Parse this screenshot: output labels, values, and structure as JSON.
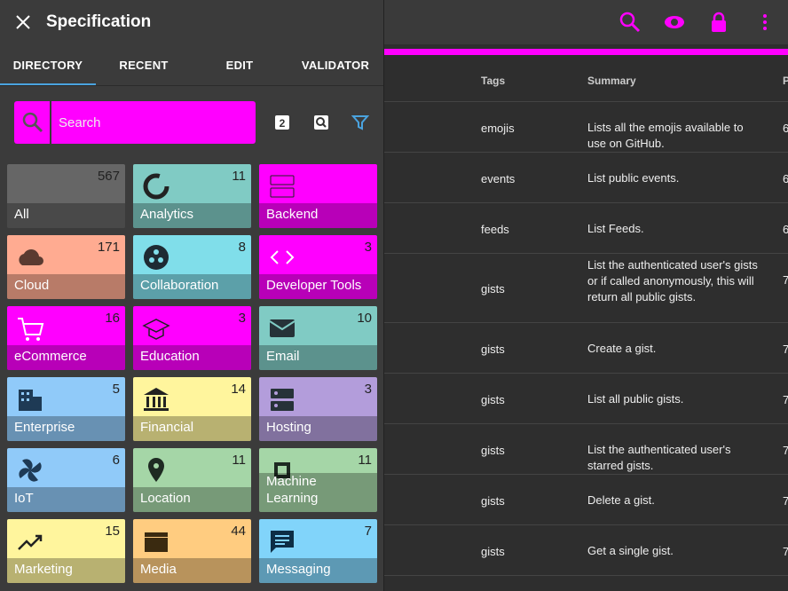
{
  "drawer": {
    "title": "Specification",
    "tabs": [
      "DIRECTORY",
      "RECENT",
      "EDIT",
      "VALIDATOR"
    ],
    "search_placeholder": "Search",
    "tiles": [
      {
        "label": "All",
        "count": "567",
        "color": "#666666",
        "icon": "none"
      },
      {
        "label": "Analytics",
        "count": "11",
        "color": "#80cbc4",
        "icon": "donut-icon"
      },
      {
        "label": "Backend",
        "count": "",
        "color": "#ff00ff",
        "icon": "server-icon"
      },
      {
        "label": "Cloud",
        "count": "171",
        "color": "#ffab91",
        "icon": "cloud-icon"
      },
      {
        "label": "Collaboration",
        "count": "8",
        "color": "#80deea",
        "icon": "group-icon"
      },
      {
        "label": "Developer Tools",
        "count": "3",
        "color": "#ff00ff",
        "icon": "code-icon"
      },
      {
        "label": "eCommerce",
        "count": "16",
        "color": "#ff00ff",
        "icon": "cart-icon"
      },
      {
        "label": "Education",
        "count": "3",
        "color": "#ff00ff",
        "icon": "school-icon"
      },
      {
        "label": "Email",
        "count": "10",
        "color": "#80cbc4",
        "icon": "mail-icon"
      },
      {
        "label": "Enterprise",
        "count": "5",
        "color": "#90caf9",
        "icon": "building-icon"
      },
      {
        "label": "Financial",
        "count": "14",
        "color": "#fff59d",
        "icon": "bank-icon"
      },
      {
        "label": "Hosting",
        "count": "3",
        "color": "#b39ddb",
        "icon": "dns-icon"
      },
      {
        "label": "IoT",
        "count": "6",
        "color": "#90caf9",
        "icon": "fan-icon"
      },
      {
        "label": "Location",
        "count": "11",
        "color": "#a5d6a7",
        "icon": "pin-icon"
      },
      {
        "label": "Machine Learning",
        "count": "11",
        "color": "#a5d6a7",
        "icon": "chip-icon"
      },
      {
        "label": "Marketing",
        "count": "15",
        "color": "#fff59d",
        "icon": "trend-icon"
      },
      {
        "label": "Media",
        "count": "44",
        "color": "#ffcc80",
        "icon": "clapper-icon"
      },
      {
        "label": "Messaging",
        "count": "7",
        "color": "#81d4fa",
        "icon": "message-icon"
      }
    ]
  },
  "table": {
    "headers": {
      "tags": "Tags",
      "summary": "Summary",
      "extra": "P"
    },
    "rows": [
      {
        "tag": "emojis",
        "summary": "Lists all the emojis available to use on GitHub.",
        "extra": "6"
      },
      {
        "tag": "events",
        "summary": "List public events.",
        "extra": "6"
      },
      {
        "tag": "feeds",
        "summary": "List Feeds.",
        "extra": "6"
      },
      {
        "tag": "gists",
        "summary": "List the authenticated user's gists or if called anonymously, this will return all public gists.",
        "extra": "7"
      },
      {
        "tag": "gists",
        "summary": "Create a gist.",
        "extra": "7"
      },
      {
        "tag": "gists",
        "summary": "List all public gists.",
        "extra": "7"
      },
      {
        "tag": "gists",
        "summary": "List the authenticated user's starred gists.",
        "extra": "7"
      },
      {
        "tag": "gists",
        "summary": "Delete a gist.",
        "extra": "7"
      },
      {
        "tag": "gists",
        "summary": "Get a single gist.",
        "extra": "7"
      }
    ]
  },
  "colors": {
    "accent": "#ff00ff",
    "tab_indicator": "#4aa3df",
    "filter": "#4aa3df"
  }
}
